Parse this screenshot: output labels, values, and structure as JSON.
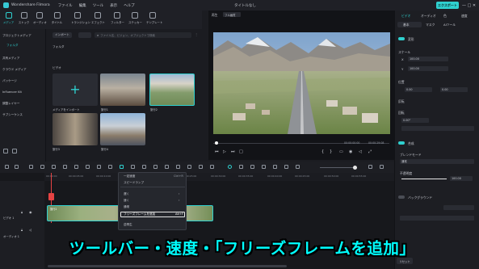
{
  "app": {
    "title": "Wondershare Filmora",
    "menus": [
      "ファイル",
      "編集",
      "ツール",
      "表示",
      "ヘルプ"
    ],
    "project_title": "タイトルなし",
    "export_label": "エクスポート"
  },
  "toolbar": {
    "tools": [
      "メディア",
      "ストック",
      "オーディオ",
      "タイトル",
      "トランジション",
      "エフェクト",
      "フィルター",
      "ステッカー",
      "テンプレート"
    ]
  },
  "library": {
    "sidebar": [
      "プロジェクトメディア",
      "フォルダ",
      "共有メディア",
      "クラウド メディア",
      "パッケージ",
      "Influencer Kit",
      "調整レイヤー",
      "サブシーケンス"
    ],
    "import_label": "インポート",
    "search_placeholder": "ファイル名、ビジョン、オブジェクトで検索",
    "folder_label": "フォルダ",
    "section_label": "ビデオ",
    "items": [
      "メディアをインポート",
      "旅行1",
      "旅行2",
      "旅行3",
      "旅行4"
    ]
  },
  "preview": {
    "player_label": "再生",
    "quality": "フル画質",
    "time_current": "00:00:00:00",
    "time_total": "00:00:29:08"
  },
  "right_panel": {
    "tabs": [
      "ビデオ",
      "オーディオ",
      "色",
      "速度"
    ],
    "subtabs": [
      "基本",
      "マスク",
      "AIツール"
    ],
    "section_transform": "変形",
    "scale_label": "スケール",
    "x_label": "X",
    "y_label": "Y",
    "x_value": "100.00",
    "y_value": "100.00",
    "position_label": "位置",
    "pos_x": "0.00",
    "pos_y": "0.00",
    "flip_label": "反転",
    "rotate_label": "回転",
    "rotate_value": "0.00°",
    "section_compose": "合成",
    "blend_label": "ブレンドモード",
    "blend_value": "通常",
    "opacity_label": "不透明度",
    "opacity_value": "100.00",
    "opacity_fraction": 1.0,
    "bg_label": "バックグラウンド",
    "reset_label": "リセット"
  },
  "timeline": {
    "ticks": [
      "00:00:00",
      "00:00:05:00",
      "00:00:10:00",
      "00:00:15:00",
      "00:00:20:00",
      "00:00:25:00",
      "00:00:30:00",
      "00:00:35:00",
      "00:00:40:00",
      "00:00:45:00",
      "00:00:50:00",
      "00:00:55:00"
    ],
    "track_video": "ビデオ 1",
    "track_audio": "オーディオ 1",
    "clip_label": "旅行2"
  },
  "context_menu": {
    "items": [
      "一定速度",
      "スピードランプ",
      "遅く",
      "速く",
      "通常",
      "フリーズフレームを追加",
      "逆再生"
    ],
    "shortcut_const": "Ctrl+R",
    "shortcut_freeze": "Alt+F"
  },
  "caption": "ツールバー・速度・「フリーズフレームを追加」"
}
